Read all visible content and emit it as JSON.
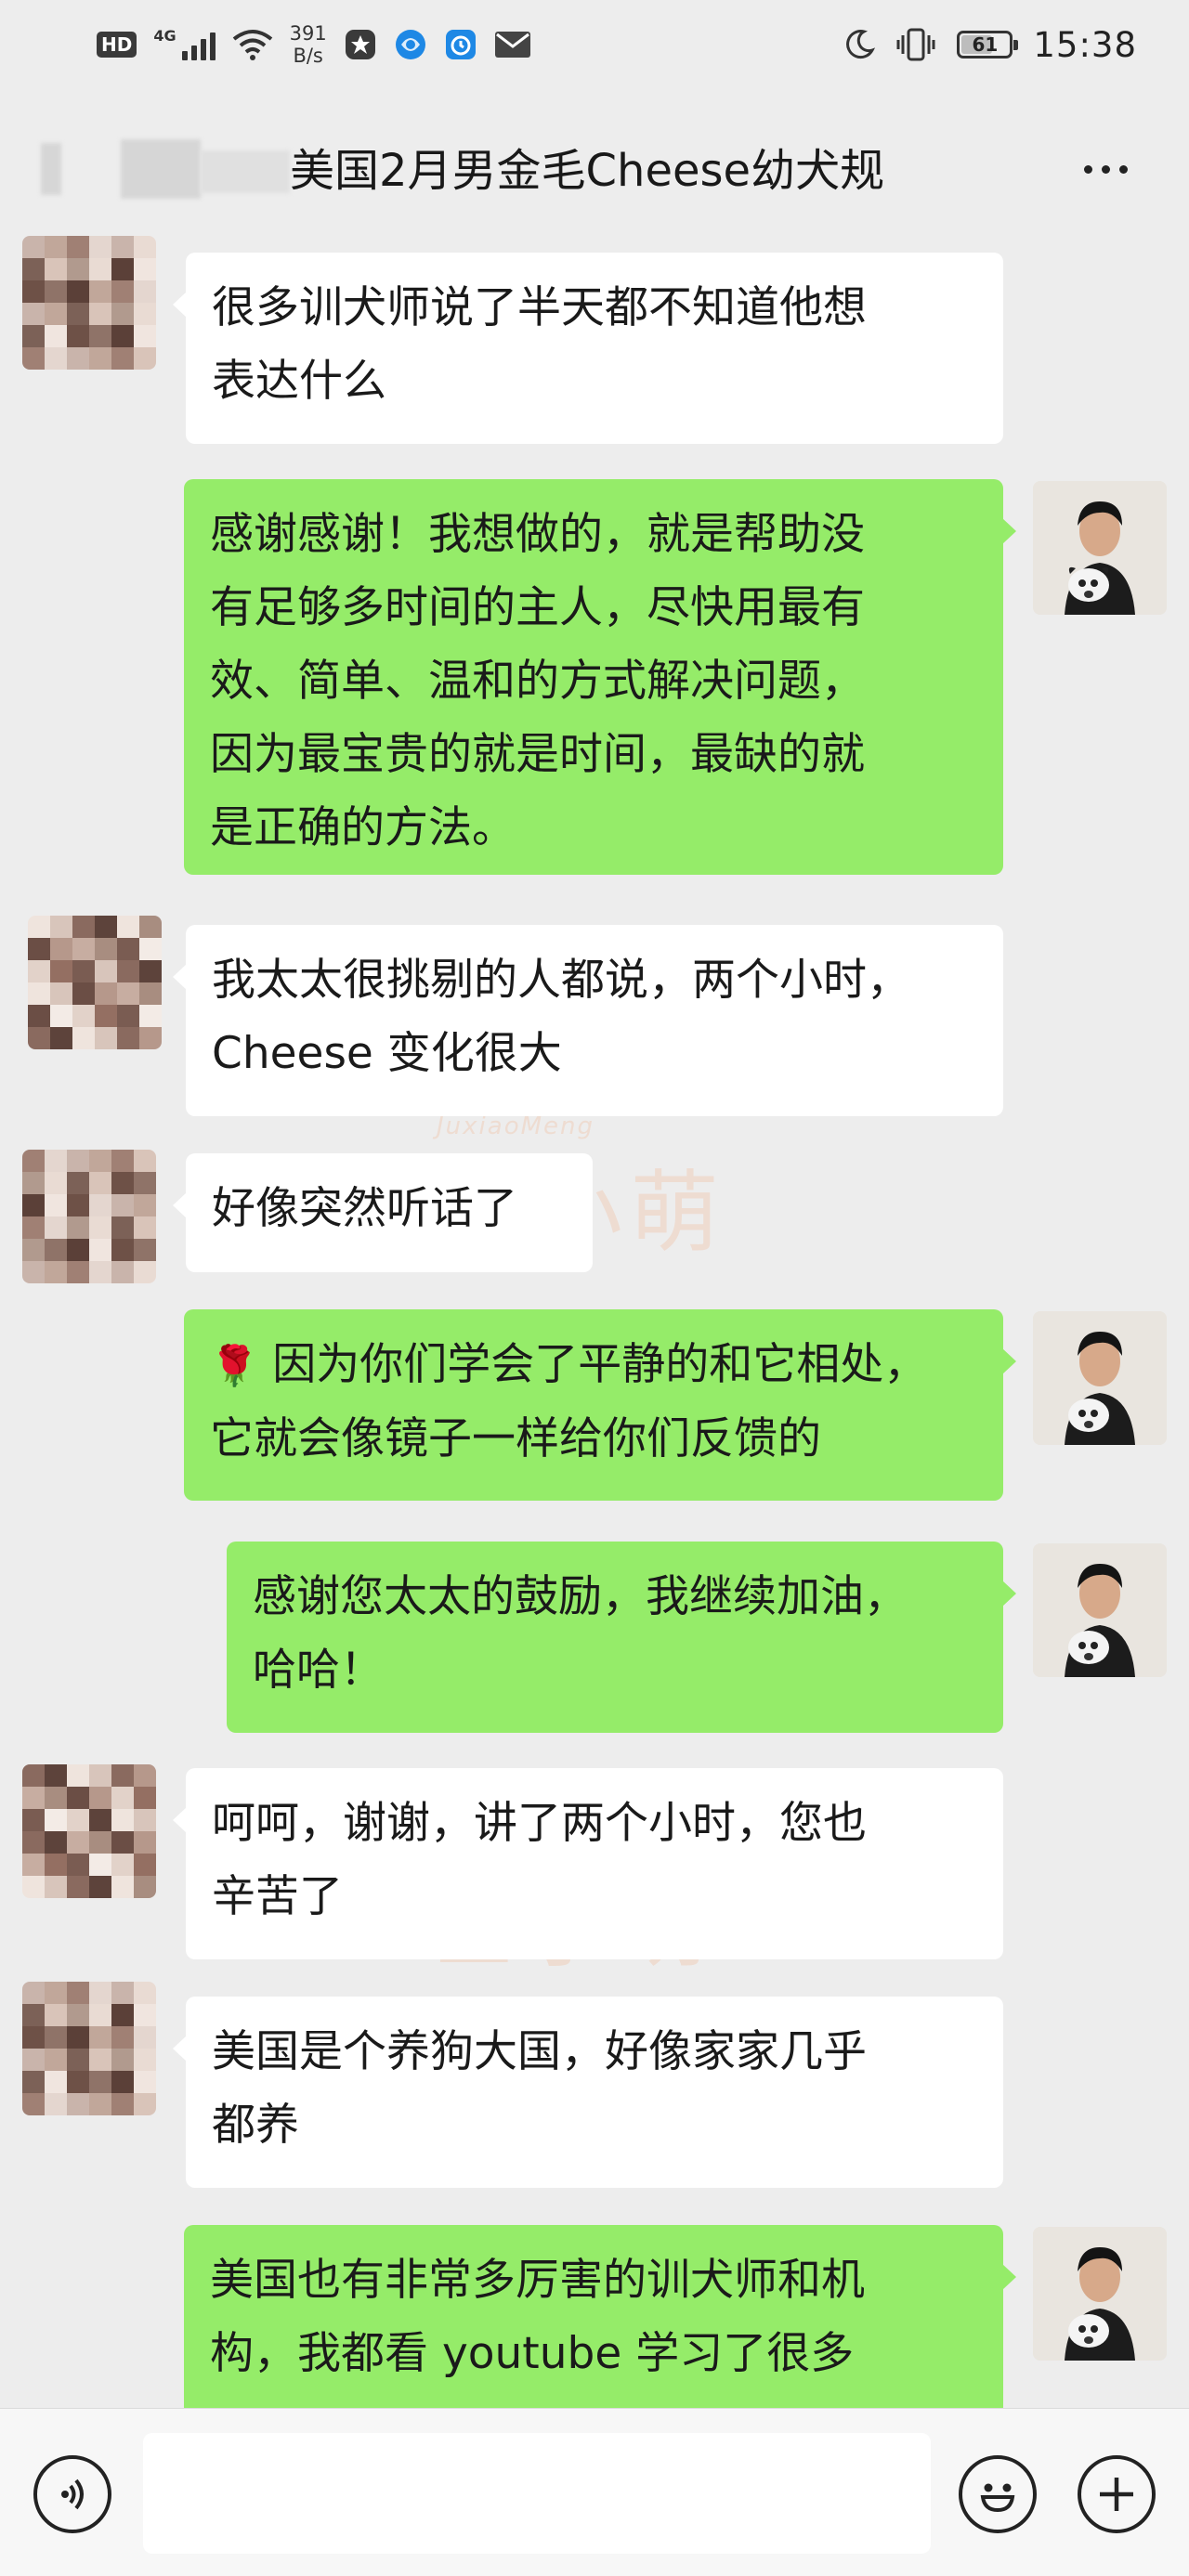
{
  "status_bar": {
    "hd": "HD",
    "network": "4G",
    "speed_value": "391",
    "speed_unit": "B/s",
    "battery": "61",
    "battery_level": 0.61,
    "time": "15:38"
  },
  "header": {
    "title": "美国2月男金毛Cheese幼犬规"
  },
  "watermark": {
    "text": "巨小萌",
    "latin": "JuxiaoMeng"
  },
  "messages": [
    {
      "side": "in",
      "lines": [
        "很多训犬师说了半天都不知道他想",
        "表达什么"
      ]
    },
    {
      "side": "out",
      "lines": [
        "感谢感谢！我想做的，就是帮助没",
        "有足够多时间的主人，尽快用最有",
        "效、简单、温和的方式解决问题，",
        "因为最宝贵的就是时间，最缺的就",
        "是正确的方法。"
      ]
    },
    {
      "side": "in",
      "lines": [
        "我太太很挑剔的人都说，两个小时，",
        "Cheese 变化很大"
      ]
    },
    {
      "side": "in",
      "lines": [
        "好像突然听话了"
      ]
    },
    {
      "side": "out",
      "emoji": "🌹",
      "lines": [
        "因为你们学会了平静的和它相处，",
        "它就会像镜子一样给你们反馈的"
      ]
    },
    {
      "side": "out",
      "lines": [
        "感谢您太太的鼓励，我继续加油，",
        "哈哈！"
      ]
    },
    {
      "side": "in",
      "lines": [
        "呵呵，谢谢，讲了两个小时，您也",
        "辛苦了"
      ]
    },
    {
      "side": "in",
      "lines": [
        "美国是个养狗大国，好像家家几乎",
        "都养"
      ]
    },
    {
      "side": "out",
      "lines": [
        "美国也有非常多厉害的训犬师和机",
        "构，我都看 youtube 学习了很多"
      ]
    }
  ],
  "input_bar": {
    "placeholder": ""
  },
  "colors": {
    "background": "#ededed",
    "bubble_out": "#95ec69",
    "bubble_in": "#ffffff"
  },
  "icons": [
    "signal-icon",
    "wifi-icon",
    "app-icon",
    "moon-icon",
    "vibrate-icon",
    "more-icon",
    "voice-icon",
    "emoji-icon",
    "add-icon"
  ]
}
